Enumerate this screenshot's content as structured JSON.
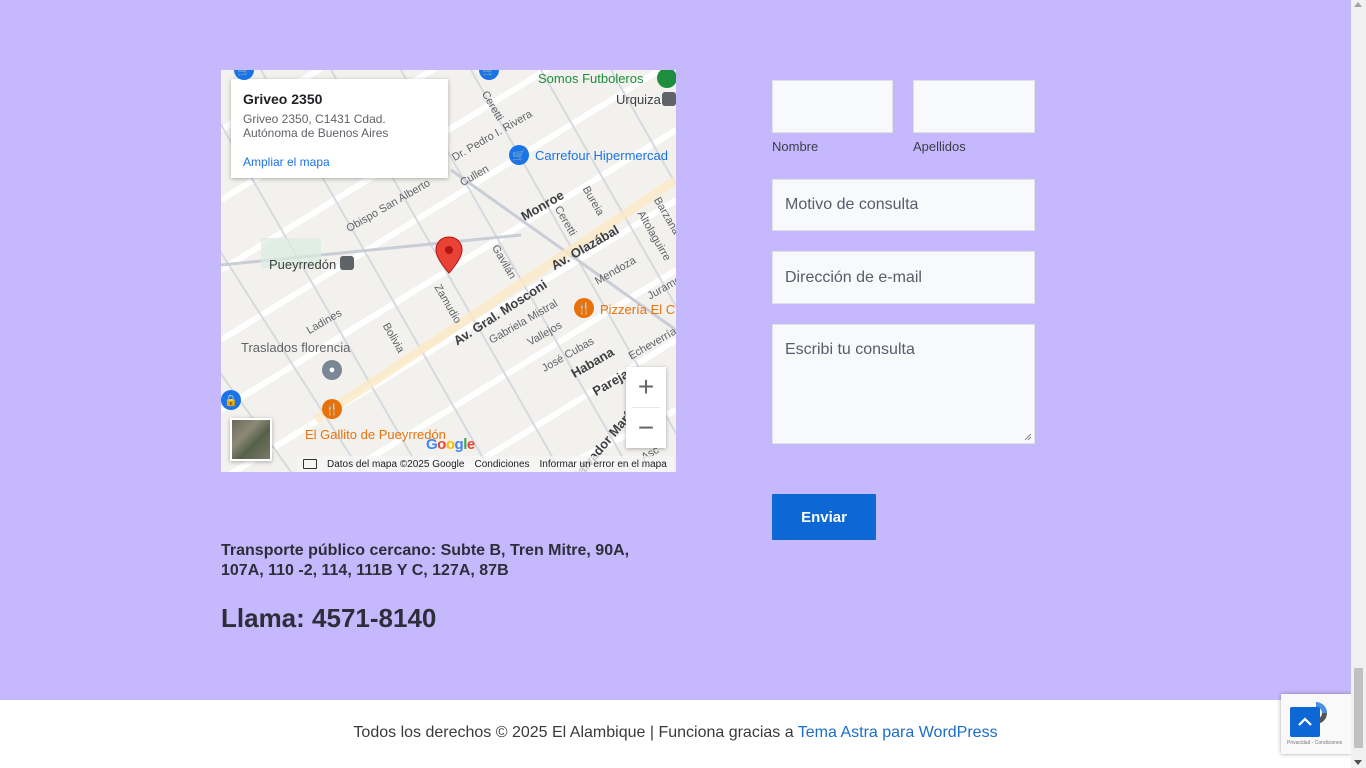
{
  "map": {
    "card_title": "Griveo 2350",
    "card_address": "Griveo 2350, C1431 Cdad. Autónoma de Buenos Aires",
    "card_link": "Ampliar el mapa",
    "places": {
      "somos": "Somos Futboleros",
      "urquiza": "Urquiza",
      "carrefour": "Carrefour Hipermercad",
      "pueyrredon": "Pueyrredón",
      "pizzeria": "Pizzería El C",
      "traslados": "Traslados florencia",
      "gallito": "El Gallito de Pueyrredón"
    },
    "streets": {
      "monroe": "Monroe",
      "olazabal": "Av. Olazábal",
      "mosconi": "Av. Gral. Mosconi",
      "habana": "Habana",
      "pareja": "Pareja",
      "zamudio": "Zamudio",
      "bolivia": "Bolivia",
      "ladines": "Ladines",
      "gavilan": "Gavilán",
      "mistral": "Gabriela Mistral",
      "vallejos": "Vallejos",
      "cubas": "José Cubas",
      "mendoza": "Mendoza",
      "bureia": "Bureia",
      "ceretti": "Ceretti",
      "ceretti2": "Ceretti",
      "altolaguirre": "Altolaguirre",
      "barzana": "Barzana",
      "cullen": "Cullen",
      "obispo": "Obispo San Alberto",
      "pedro": "Dr. Pedro I. Rivera",
      "echeverria": "Echeverría",
      "jurame": "Jurame",
      "salvador": "Salvador María del C",
      "asc": "Asc"
    },
    "zoom_in": "+",
    "zoom_out": "−",
    "attrib_data": "Datos del mapa ©2025 Google",
    "attrib_terms": "Condiciones",
    "attrib_report": "Informar un error en el mapa",
    "google": "Google"
  },
  "info": {
    "transport": "Transporte público cercano: Subte B, Tren Mitre, 90A, 107A, 110 -2, 114, 111B Y C, 127A, 87B",
    "phone": "Llama: 4571-8140"
  },
  "form": {
    "nombre_label": "Nombre",
    "apellidos_label": "Apellidos",
    "motivo_placeholder": "Motivo de consulta",
    "email_placeholder": "Dirección de e-mail",
    "consulta_placeholder": "Escribi tu consulta",
    "submit": "Enviar"
  },
  "footer": {
    "text": "Todos los derechos © 2025 El Alambique | Funciona gracias a ",
    "link": "Tema Astra para WordPress"
  },
  "recaptcha": {
    "text": "Privacidad - Condiciones"
  },
  "colors": {
    "background": "#c6b8fd",
    "accent": "#0d68d6",
    "map_pin": "#ea4335"
  }
}
